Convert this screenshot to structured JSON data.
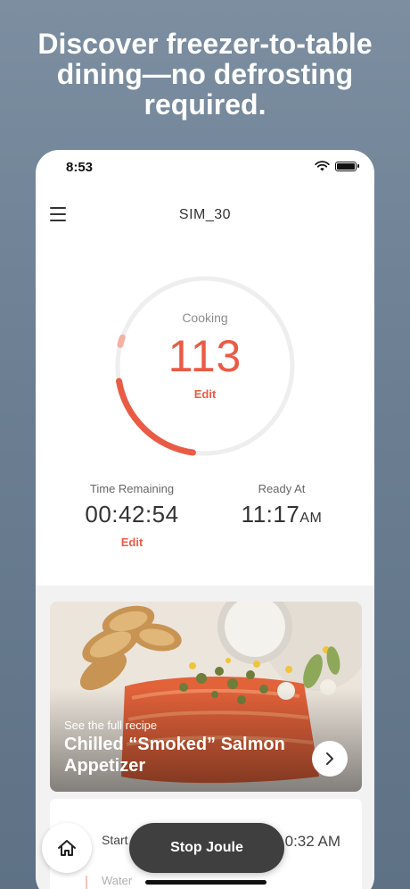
{
  "promo": {
    "headline": "Discover freezer-to-table dining—no defrosting required."
  },
  "status_bar": {
    "time": "8:53",
    "icons": [
      "wifi-icon",
      "battery-icon"
    ]
  },
  "nav": {
    "title": "SIM_30",
    "menu_icon": "hamburger-menu-icon"
  },
  "dial": {
    "label": "Cooking",
    "value": "113",
    "edit_label": "Edit",
    "progress_fraction": 0.2,
    "colors": {
      "track": "#eeeeee",
      "progress": "#ea5b46",
      "target_marker": "#f4b1a6"
    }
  },
  "time_remaining": {
    "label": "Time Remaining",
    "value": "00:42:54",
    "edit_label": "Edit"
  },
  "ready_at": {
    "label": "Ready At",
    "time": "11:17",
    "ampm": "AM"
  },
  "recipe": {
    "subtitle": "See the full recipe",
    "title": "Chilled “Smoked” Salmon Appetizer",
    "next_icon": "chevron-right-icon"
  },
  "steps": {
    "start_label": "Start",
    "start_time": "10:32 AM",
    "water_label": "Water"
  },
  "actions": {
    "stop_label": "Stop Joule",
    "home_icon": "home-icon"
  },
  "colors": {
    "accent": "#ea5b46",
    "background": "#6b7e92",
    "button_dark": "#3f3f3f"
  }
}
